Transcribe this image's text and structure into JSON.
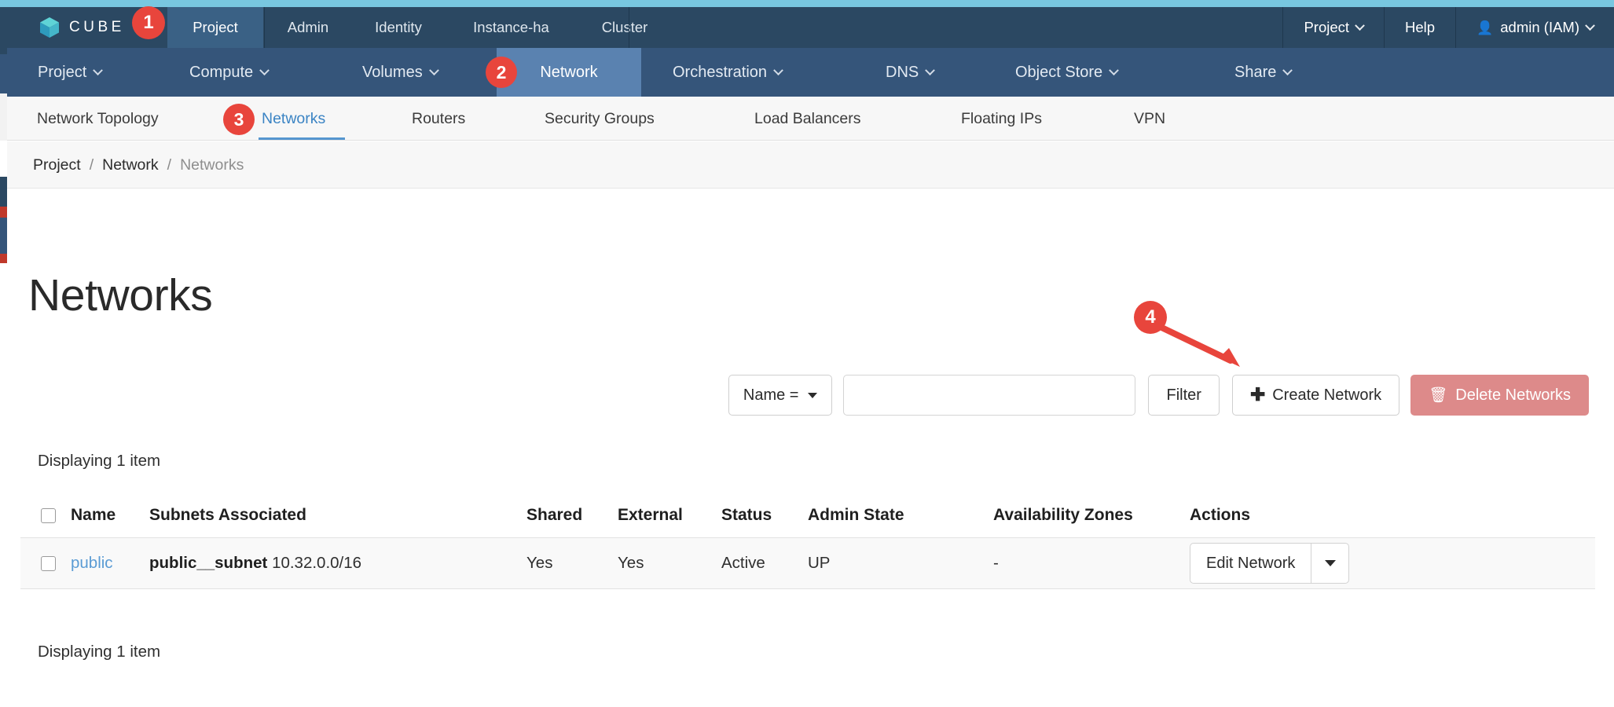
{
  "brand": {
    "name": "CUBE",
    "logo_icon": "cube-logo-icon"
  },
  "theme": {
    "topbar_accent": "#78c7e0",
    "navbar_bg": "#2b4862",
    "subnav_bg": "#35557a",
    "subnav_selected_bg": "#5a82b0",
    "link_blue": "#5a9bd4",
    "annotation_red": "#e8453c",
    "danger_button": "#dd8a8a"
  },
  "topnav": {
    "items": [
      {
        "label": "Project",
        "selected": true
      },
      {
        "label": "Admin",
        "selected": false
      },
      {
        "label": "Identity",
        "selected": false
      },
      {
        "label": "Instance-ha",
        "selected": false
      },
      {
        "label": "Cluster",
        "selected": false
      }
    ],
    "right": {
      "project_label": "Project",
      "help_label": "Help",
      "user_label": "admin (IAM)",
      "user_icon": "user-icon",
      "chevron_icon": "chevron-down-icon"
    }
  },
  "subnav": {
    "items": [
      {
        "label": "Project",
        "has_caret": true,
        "selected": false
      },
      {
        "label": "Compute",
        "has_caret": true,
        "selected": false
      },
      {
        "label": "Volumes",
        "has_caret": true,
        "selected": false
      },
      {
        "label": "Network",
        "has_caret": false,
        "selected": true
      },
      {
        "label": "Orchestration",
        "has_caret": true,
        "selected": false
      },
      {
        "label": "DNS",
        "has_caret": true,
        "selected": false
      },
      {
        "label": "Object Store",
        "has_caret": true,
        "selected": false
      },
      {
        "label": "Share",
        "has_caret": true,
        "selected": false
      }
    ]
  },
  "tabs": {
    "items": [
      {
        "label": "Network Topology",
        "selected": false
      },
      {
        "label": "Networks",
        "selected": true
      },
      {
        "label": "Routers",
        "selected": false
      },
      {
        "label": "Security Groups",
        "selected": false
      },
      {
        "label": "Load Balancers",
        "selected": false
      },
      {
        "label": "Floating IPs",
        "selected": false
      },
      {
        "label": "VPN",
        "selected": false
      }
    ]
  },
  "breadcrumb": {
    "items": [
      "Project",
      "Network",
      "Networks"
    ],
    "separator": "/"
  },
  "page": {
    "title": "Networks"
  },
  "toolbar": {
    "filter_select_label": "Name =",
    "filter_input_value": "",
    "filter_input_placeholder": "",
    "filter_button_label": "Filter",
    "create_button_label": "Create Network",
    "create_button_icon": "plus-icon",
    "delete_button_label": "Delete Networks",
    "delete_button_icon": "trash-icon"
  },
  "table": {
    "count_top": "Displaying 1 item",
    "count_bottom": "Displaying 1 item",
    "columns": [
      "Name",
      "Subnets Associated",
      "Shared",
      "External",
      "Status",
      "Admin State",
      "Availability Zones",
      "Actions"
    ],
    "rows": [
      {
        "name": "public",
        "subnet_name": "public__subnet",
        "subnet_cidr": "10.32.0.0/16",
        "shared": "Yes",
        "external": "Yes",
        "status": "Active",
        "admin_state": "UP",
        "availability_zones": "-",
        "action_label": "Edit Network",
        "action_dropdown_icon": "caret-down-icon"
      }
    ]
  },
  "annotations": {
    "badges": [
      {
        "number": "1"
      },
      {
        "number": "2"
      },
      {
        "number": "3"
      },
      {
        "number": "4"
      }
    ],
    "arrow": {
      "target": "create-network-button"
    }
  }
}
